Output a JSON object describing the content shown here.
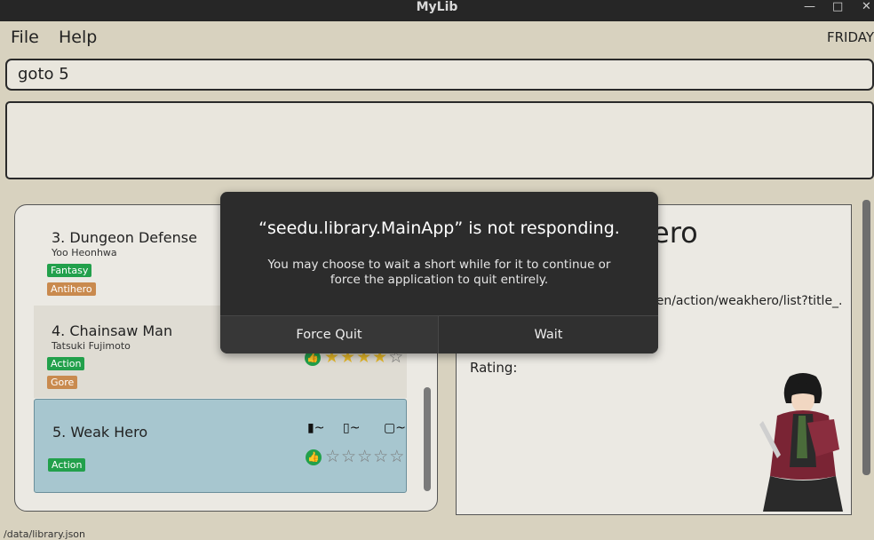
{
  "window": {
    "title": "MyLib"
  },
  "menu": {
    "file": "File",
    "help": "Help",
    "day": "FRIDAY"
  },
  "command": {
    "value": "goto 5"
  },
  "result": {
    "text": ""
  },
  "list": [
    {
      "index": "3.",
      "title": "Dungeon Defense",
      "author": "Yoo Heonhwa",
      "tags": [
        "Fantasy",
        "Antihero"
      ]
    },
    {
      "index": "4.",
      "title": "Chainsaw Man",
      "author": "Tatsuki Fujimoto",
      "tags": [
        "Action",
        "Gore"
      ],
      "rating": 4
    },
    {
      "index": "5.",
      "title": "Weak Hero",
      "author": "",
      "tags": [
        "Action"
      ],
      "rating": 0,
      "progress": {
        "volume": "~",
        "chapter": "~",
        "page": "~"
      }
    }
  ],
  "detail": {
    "title_partial": "ero",
    "url_partial": "/en/action/weakhero/list?title_.",
    "rating_label": "Rating:"
  },
  "footer": {
    "text": "/data/library.json"
  },
  "dialog": {
    "title": "“seedu.library.MainApp” is not responding.",
    "message": "You may choose to wait a short while for it to continue or force the application to quit entirely.",
    "force_quit": "Force Quit",
    "wait": "Wait"
  },
  "icons": {
    "minimize": "minimize-icon",
    "maximize": "maximize-icon",
    "close": "close-icon",
    "thumbs_up": "thumbs-up-icon",
    "star": "star-icon"
  },
  "colors": {
    "tag_genre": "#22a04b",
    "tag_theme": "#c98a4e",
    "selected_card": "#a7c6cf",
    "dialog_bg": "#2c2c2c"
  }
}
